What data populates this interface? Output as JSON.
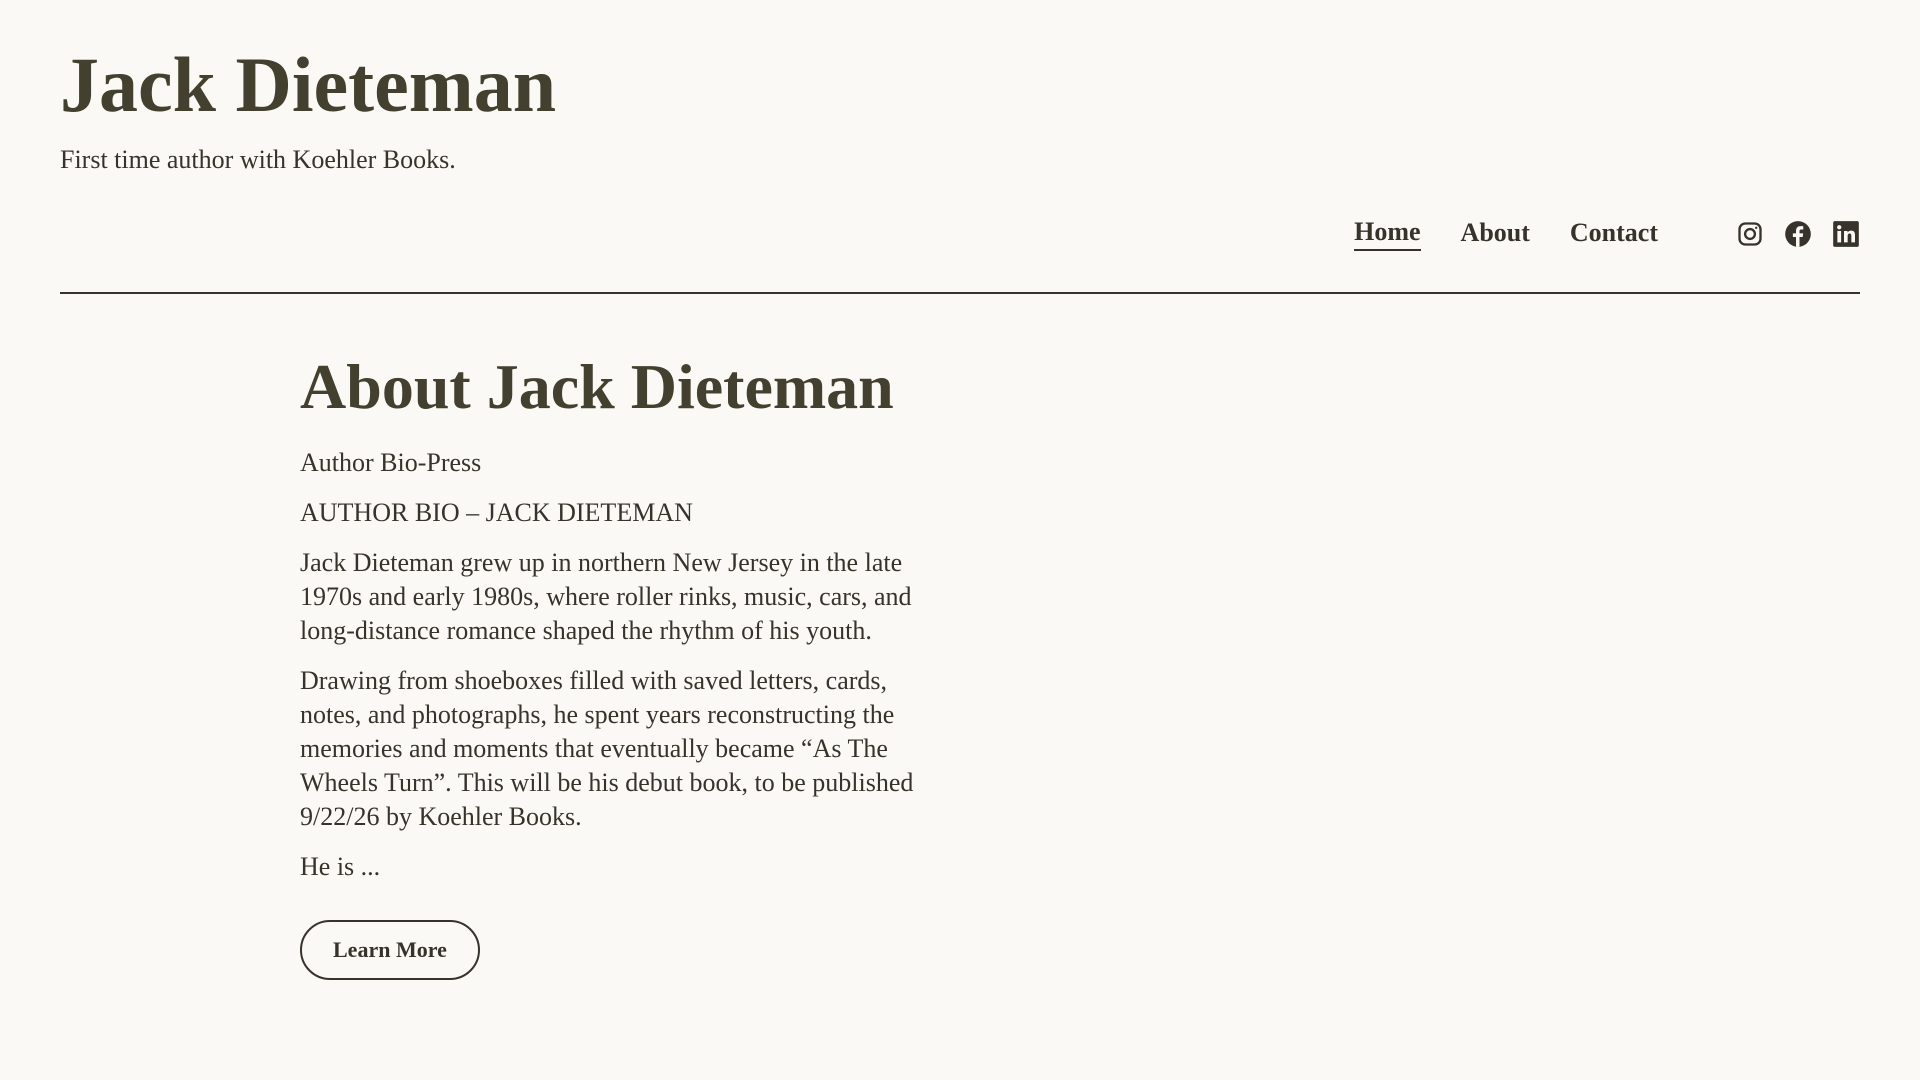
{
  "site": {
    "title": "Jack Dieteman",
    "tagline": "First time author with Koehler Books."
  },
  "nav": {
    "items": [
      {
        "label": "Home",
        "active": true
      },
      {
        "label": "About",
        "active": false
      },
      {
        "label": "Contact",
        "active": false
      }
    ],
    "social": [
      "instagram-icon",
      "facebook-icon",
      "linkedin-icon"
    ]
  },
  "main": {
    "heading": "About Jack Dieteman",
    "paragraphs": [
      "Author Bio-Press",
      "AUTHOR BIO – JACK DIETEMAN",
      "Jack Dieteman grew up in northern New Jersey in the late 1970s and early 1980s, where roller rinks, music, cars, and long-distance romance shaped the rhythm of his youth.",
      "Drawing from shoeboxes filled with saved letters, cards, notes, and photographs, he spent years reconstructing the memories and moments that eventually became “As The Wheels Turn”. This will be his debut book, to be published 9/22/26 by Koehler Books.",
      "He is ..."
    ],
    "button_label": "Learn More"
  },
  "colors": {
    "background": "#faf9f5",
    "text": "#37332b",
    "heading": "#44402f"
  }
}
